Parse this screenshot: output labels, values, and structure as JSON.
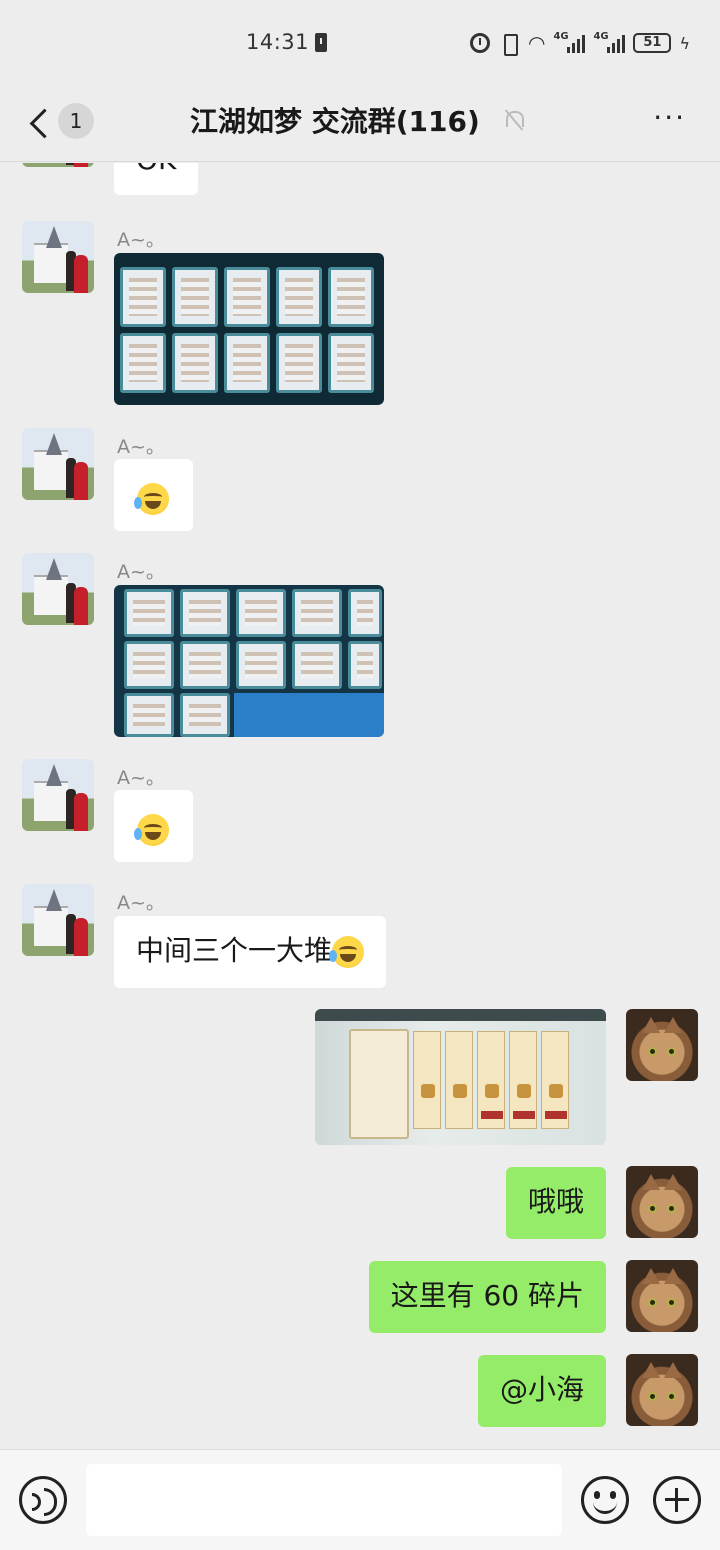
{
  "status_bar": {
    "time": "14:31",
    "signal1_tag": "4G",
    "signal2_tag": "4G",
    "battery": "51"
  },
  "nav": {
    "unread_count": "1",
    "title": "江湖如梦 交流群(116)"
  },
  "messages": [
    {
      "side": "left",
      "sender": "",
      "type": "text",
      "text": "OK"
    },
    {
      "side": "left",
      "sender": "A~。",
      "type": "image"
    },
    {
      "side": "left",
      "sender": "A~。",
      "type": "emoji",
      "icon": "facepalm-cry-emoji"
    },
    {
      "side": "left",
      "sender": "A~。",
      "type": "image"
    },
    {
      "side": "left",
      "sender": "A~。",
      "type": "emoji",
      "icon": "facepalm-cry-emoji"
    },
    {
      "side": "left",
      "sender": "A~。",
      "type": "text",
      "text": "中间三个一大堆"
    },
    {
      "side": "right",
      "type": "image"
    },
    {
      "side": "right",
      "type": "text",
      "text": "哦哦"
    },
    {
      "side": "right",
      "type": "text",
      "text": "这里有 60 碎片"
    },
    {
      "side": "right",
      "type": "text",
      "text": "@小海"
    }
  ],
  "colors": {
    "background": "#ededed",
    "bubble_self": "#95ec69",
    "bubble_other": "#ffffff"
  }
}
